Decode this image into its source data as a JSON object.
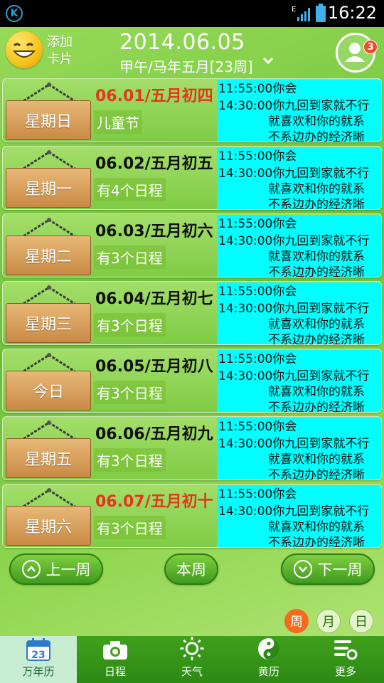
{
  "status_bar": {
    "time": "16:22",
    "network": "E"
  },
  "header": {
    "add_card": [
      "添加",
      "卡片"
    ],
    "date": "2014.06.05",
    "lunar": "甲午/马年五月[23周]",
    "notification_count": "3"
  },
  "days": [
    {
      "weekday": "星期日",
      "date": "06.01/五月初四",
      "highlight": true,
      "subtitle": "儿童节",
      "schedule": [
        "11:55:00你会",
        "14:30:00你九回到家就不行",
        "就喜欢和你的就系",
        "不系边办的经济晰"
      ]
    },
    {
      "weekday": "星期一",
      "date": "06.02/五月初五",
      "highlight": false,
      "subtitle": "有4个日程",
      "schedule": [
        "11:55:00你会",
        "14:30:00你九回到家就不行",
        "就喜欢和你的就系",
        "不系边办的经济晰"
      ]
    },
    {
      "weekday": "星期二",
      "date": "06.03/五月初六",
      "highlight": false,
      "subtitle": "有3个日程",
      "schedule": [
        "11:55:00你会",
        "14:30:00你九回到家就不行",
        "就喜欢和你的就系",
        "不系边办的经济晰"
      ]
    },
    {
      "weekday": "星期三",
      "date": "06.04/五月初七",
      "highlight": false,
      "subtitle": "有3个日程",
      "schedule": [
        "11:55:00你会",
        "14:30:00你九回到家就不行",
        "就喜欢和你的就系",
        "不系边办的经济晰"
      ]
    },
    {
      "weekday": "今日",
      "date": "06.05/五月初八",
      "highlight": false,
      "subtitle": "有3个日程",
      "schedule": [
        "11:55:00你会",
        "14:30:00你九回到家就不行",
        "就喜欢和你的就系",
        "不系边办的经济晰"
      ]
    },
    {
      "weekday": "星期五",
      "date": "06.06/五月初九",
      "highlight": false,
      "subtitle": "有3个日程",
      "schedule": [
        "11:55:00你会",
        "14:30:00你九回到家就不行",
        "就喜欢和你的就系",
        "不系边办的经济晰"
      ]
    },
    {
      "weekday": "星期六",
      "date": "06.07/五月初十",
      "highlight": true,
      "subtitle": "有3个日程",
      "schedule": [
        "11:55:00你会",
        "14:30:00你九回到家就不行",
        "就喜欢和你的就系",
        "不系边办的经济晰"
      ]
    }
  ],
  "week_nav": {
    "prev": "上一周",
    "current": "本周",
    "next": "下一周"
  },
  "view_toggles": [
    {
      "label": "周",
      "active": true
    },
    {
      "label": "月",
      "active": false
    },
    {
      "label": "日",
      "active": false
    }
  ],
  "bottom_nav": [
    {
      "label": "万年历",
      "icon": "calendar-icon",
      "active": true,
      "calendar_day": "23"
    },
    {
      "label": "日程",
      "icon": "camera-icon",
      "active": false
    },
    {
      "label": "天气",
      "icon": "sun-icon",
      "active": false
    },
    {
      "label": "黄历",
      "icon": "yin-yang-icon",
      "active": false
    },
    {
      "label": "更多",
      "icon": "more-settings-icon",
      "active": false
    }
  ],
  "colors": {
    "holiday_red": "#e3361a",
    "schedule_bg": "#00ffff",
    "toggle_active": "#f56a1c",
    "nav_bg": "#2c8a14"
  }
}
